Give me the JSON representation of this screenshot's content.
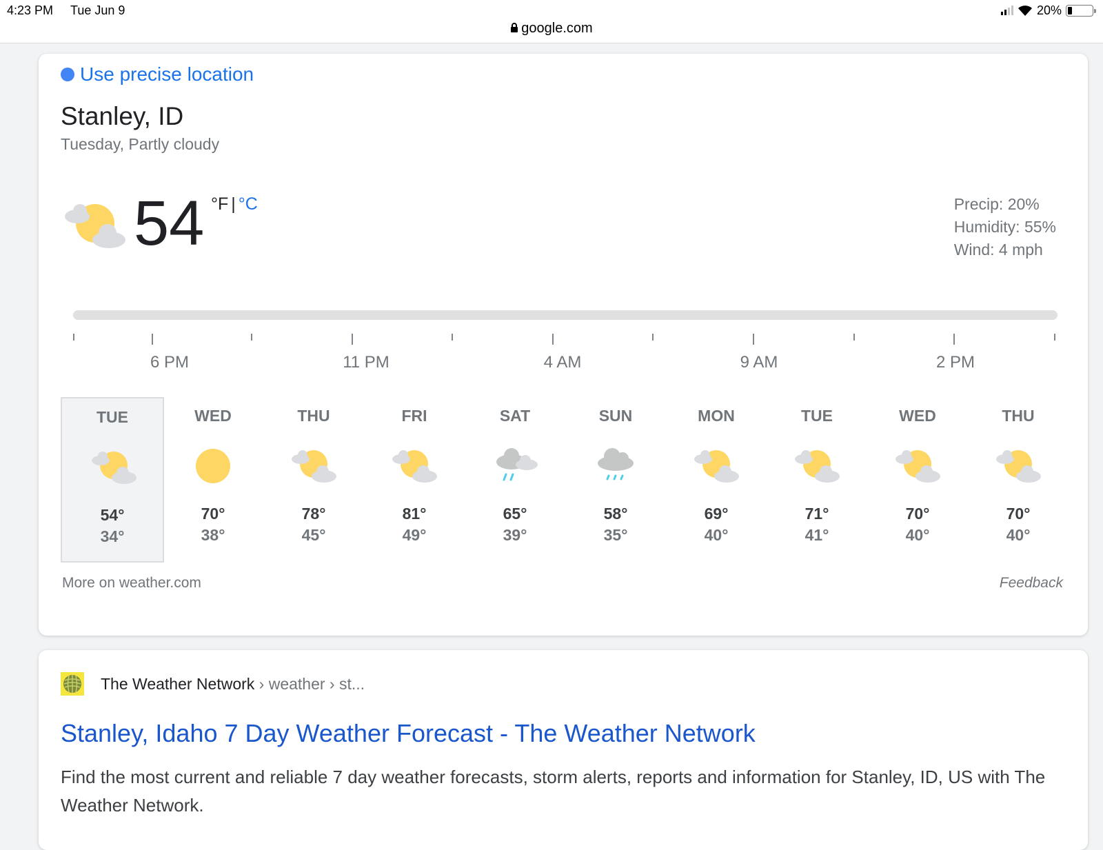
{
  "status_bar": {
    "time": "4:23 PM",
    "date": "Tue Jun 9",
    "url": "google.com",
    "battery": "20%"
  },
  "weather": {
    "precise_location": "Use precise location",
    "location": "Stanley, ID",
    "subtitle": "Tuesday, Partly cloudy",
    "temperature": "54",
    "unit_f": "°F",
    "unit_sep": "|",
    "unit_c": "°C",
    "precip": "Precip: 20%",
    "humidity": "Humidity: 55%",
    "wind": "Wind: 4 mph",
    "time_labels": [
      "6 PM",
      "11 PM",
      "4 AM",
      "9 AM",
      "2 PM"
    ],
    "days": [
      {
        "name": "TUE",
        "icon": "partly-cloudy-icon",
        "hi": "54°",
        "lo": "34°"
      },
      {
        "name": "WED",
        "icon": "sunny-icon",
        "hi": "70°",
        "lo": "38°"
      },
      {
        "name": "THU",
        "icon": "partly-cloudy-icon",
        "hi": "78°",
        "lo": "45°"
      },
      {
        "name": "FRI",
        "icon": "partly-cloudy-icon",
        "hi": "81°",
        "lo": "49°"
      },
      {
        "name": "SAT",
        "icon": "rain-cloud-icon",
        "hi": "65°",
        "lo": "39°"
      },
      {
        "name": "SUN",
        "icon": "showers-icon",
        "hi": "58°",
        "lo": "35°"
      },
      {
        "name": "MON",
        "icon": "partly-cloudy-icon",
        "hi": "69°",
        "lo": "40°"
      },
      {
        "name": "TUE",
        "icon": "partly-cloudy-icon",
        "hi": "71°",
        "lo": "41°"
      },
      {
        "name": "WED",
        "icon": "partly-cloudy-icon",
        "hi": "70°",
        "lo": "40°"
      },
      {
        "name": "THU",
        "icon": "partly-cloudy-icon",
        "hi": "70°",
        "lo": "40°"
      }
    ],
    "more_link": "More on weather.com",
    "feedback": "Feedback"
  },
  "result": {
    "source_name": "The Weather Network",
    "crumbs": "› weather › st...",
    "title": "Stanley, Idaho 7 Day Weather Forecast - The Weather Network",
    "snippet": "Find the most current and reliable 7 day weather forecasts, storm alerts, reports and information for Stanley, ID, US with The Weather Network."
  },
  "colors": {
    "link": "#1a73e8",
    "sun": "#fdd663",
    "cloud": "#dadce0",
    "rain": "#4ecde6"
  }
}
